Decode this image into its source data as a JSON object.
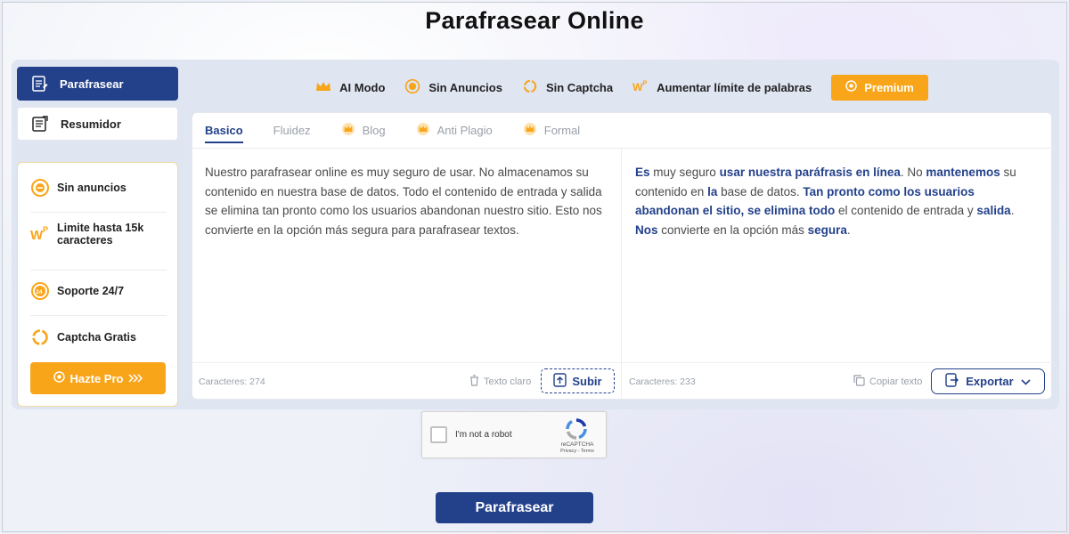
{
  "page": {
    "title": "Parafrasear Online"
  },
  "sidebar": {
    "tabs": [
      {
        "label": "Parafrasear",
        "active": true,
        "icon": "paraphrase-icon"
      },
      {
        "label": "Resumidor",
        "active": false,
        "icon": "summarizer-icon"
      }
    ],
    "features": [
      {
        "label": "Sin anuncios",
        "icon": "no-ads-icon"
      },
      {
        "label": "Limite hasta 15k caracteres",
        "icon": "word-limit-icon"
      },
      {
        "label": "Soporte 24/7",
        "icon": "support-icon"
      },
      {
        "label": "Captcha Gratis",
        "icon": "captcha-icon"
      }
    ],
    "cta_label": "Hazte Pro"
  },
  "topbar": {
    "items": [
      {
        "label": "AI Modo",
        "icon": "crown-icon"
      },
      {
        "label": "Sin Anuncios",
        "icon": "no-ads-icon"
      },
      {
        "label": "Sin Captcha",
        "icon": "captcha-icon"
      },
      {
        "label": "Aumentar límite de palabras",
        "icon": "word-limit-icon"
      }
    ],
    "premium_label": "Premium"
  },
  "modes": [
    {
      "label": "Basico",
      "active": true,
      "locked": false
    },
    {
      "label": "Fluidez",
      "active": false,
      "locked": false
    },
    {
      "label": "Blog",
      "active": false,
      "locked": true
    },
    {
      "label": "Anti Plagio",
      "active": false,
      "locked": true
    },
    {
      "label": "Formal",
      "active": false,
      "locked": true
    }
  ],
  "input": {
    "text": "Nuestro parafrasear online es muy seguro de usar. No almacenamos su contenido en nuestra base de datos. Todo el contenido de entrada y salida se elimina tan pronto como los usuarios abandonan nuestro sitio. Esto nos convierte en la opción más segura para parafrasear textos.",
    "char_count": "Caracteres: 274",
    "clear_label": "Texto claro",
    "upload_label": "Subir"
  },
  "output": {
    "segments": [
      {
        "text": "Es",
        "bold": true
      },
      {
        "text": " muy seguro ",
        "bold": false
      },
      {
        "text": "usar nuestra paráfrasis en línea",
        "bold": true
      },
      {
        "text": ".  No ",
        "bold": false
      },
      {
        "text": "mantenemos",
        "bold": true
      },
      {
        "text": " su contenido en ",
        "bold": false
      },
      {
        "text": "la",
        "bold": true
      },
      {
        "text": " base de datos.  ",
        "bold": false
      },
      {
        "text": "Tan pronto como los usuarios abandonan el sitio, se elimina todo",
        "bold": true
      },
      {
        "text": " el contenido de entrada y ",
        "bold": false
      },
      {
        "text": "salida",
        "bold": true
      },
      {
        "text": ".  ",
        "bold": false
      },
      {
        "text": "Nos",
        "bold": true
      },
      {
        "text": " convierte en la opción más ",
        "bold": false
      },
      {
        "text": "segura",
        "bold": true
      },
      {
        "text": ".",
        "bold": false
      }
    ],
    "char_count": "Caracteres: 233",
    "copy_label": "Copiar texto",
    "export_label": "Exportar"
  },
  "captcha": {
    "label": "I'm not a robot",
    "brand": "reCAPTCHA",
    "links": "Privacy - Terms"
  },
  "submit_label": "Parafrasear",
  "colors": {
    "primary": "#23418b",
    "accent": "#f9a51a"
  }
}
